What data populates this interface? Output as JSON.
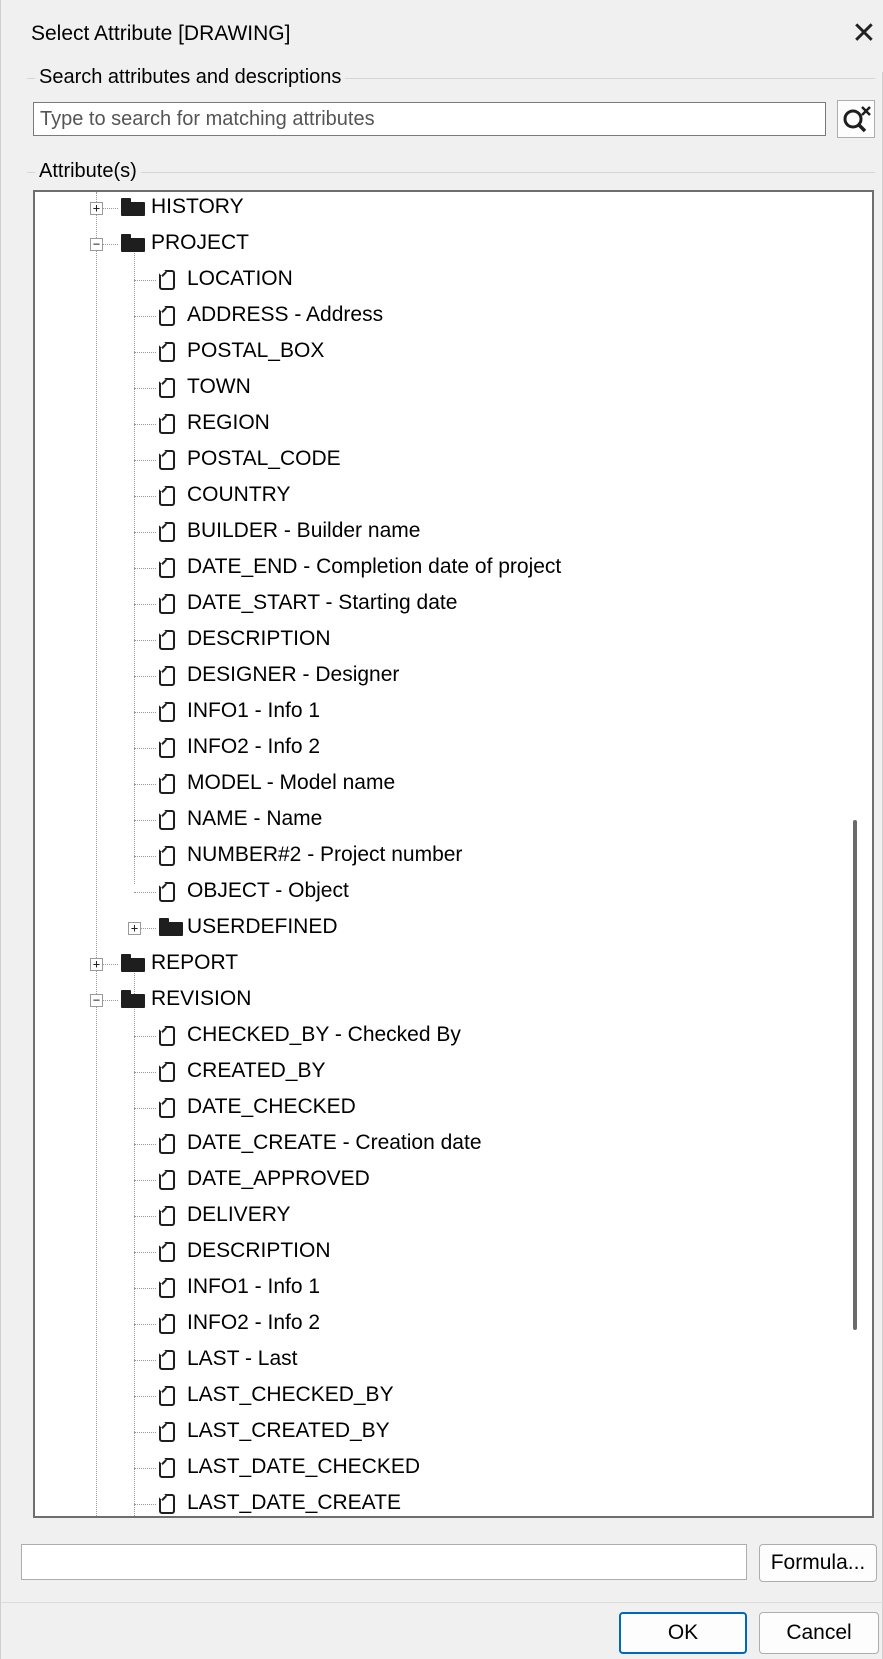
{
  "window": {
    "title": "Select Attribute [DRAWING]",
    "close_glyph": "✕"
  },
  "search": {
    "group_label": "Search attributes and descriptions",
    "placeholder": "Type to search for matching attributes",
    "clear_icon": "search-clear-icon"
  },
  "attributes": {
    "group_label": "Attribute(s)",
    "tree": [
      {
        "type": "folder",
        "level": 1,
        "label": "HISTORY",
        "expander": "+"
      },
      {
        "type": "folder",
        "level": 1,
        "label": "PROJECT",
        "expander": "−"
      },
      {
        "type": "leaf",
        "level": 2,
        "label": "LOCATION"
      },
      {
        "type": "leaf",
        "level": 2,
        "label": "ADDRESS  -  Address"
      },
      {
        "type": "leaf",
        "level": 2,
        "label": "POSTAL_BOX"
      },
      {
        "type": "leaf",
        "level": 2,
        "label": "TOWN"
      },
      {
        "type": "leaf",
        "level": 2,
        "label": "REGION"
      },
      {
        "type": "leaf",
        "level": 2,
        "label": "POSTAL_CODE"
      },
      {
        "type": "leaf",
        "level": 2,
        "label": "COUNTRY"
      },
      {
        "type": "leaf",
        "level": 2,
        "label": "BUILDER  -  Builder name"
      },
      {
        "type": "leaf",
        "level": 2,
        "label": "DATE_END  -  Completion date of project"
      },
      {
        "type": "leaf",
        "level": 2,
        "label": "DATE_START  -  Starting date"
      },
      {
        "type": "leaf",
        "level": 2,
        "label": "DESCRIPTION"
      },
      {
        "type": "leaf",
        "level": 2,
        "label": "DESIGNER  -  Designer"
      },
      {
        "type": "leaf",
        "level": 2,
        "label": "INFO1  -  Info 1"
      },
      {
        "type": "leaf",
        "level": 2,
        "label": "INFO2  -  Info 2"
      },
      {
        "type": "leaf",
        "level": 2,
        "label": "MODEL  -  Model name"
      },
      {
        "type": "leaf",
        "level": 2,
        "label": "NAME  -  Name"
      },
      {
        "type": "leaf",
        "level": 2,
        "label": "NUMBER#2  -  Project number"
      },
      {
        "type": "leaf",
        "level": 2,
        "label": "OBJECT  -  Object"
      },
      {
        "type": "folder",
        "level": 2,
        "label": "USERDEFINED",
        "expander": "+"
      },
      {
        "type": "folder",
        "level": 1,
        "label": "REPORT",
        "expander": "+"
      },
      {
        "type": "folder",
        "level": 1,
        "label": "REVISION",
        "expander": "−"
      },
      {
        "type": "leaf",
        "level": 2,
        "label": "CHECKED_BY  -  Checked By"
      },
      {
        "type": "leaf",
        "level": 2,
        "label": "CREATED_BY"
      },
      {
        "type": "leaf",
        "level": 2,
        "label": "DATE_CHECKED"
      },
      {
        "type": "leaf",
        "level": 2,
        "label": "DATE_CREATE  -  Creation date"
      },
      {
        "type": "leaf",
        "level": 2,
        "label": "DATE_APPROVED"
      },
      {
        "type": "leaf",
        "level": 2,
        "label": "DELIVERY"
      },
      {
        "type": "leaf",
        "level": 2,
        "label": "DESCRIPTION"
      },
      {
        "type": "leaf",
        "level": 2,
        "label": "INFO1  -  Info 1"
      },
      {
        "type": "leaf",
        "level": 2,
        "label": "INFO2  -  Info 2"
      },
      {
        "type": "leaf",
        "level": 2,
        "label": "LAST  -  Last"
      },
      {
        "type": "leaf",
        "level": 2,
        "label": "LAST_CHECKED_BY"
      },
      {
        "type": "leaf",
        "level": 2,
        "label": "LAST_CREATED_BY"
      },
      {
        "type": "leaf",
        "level": 2,
        "label": "LAST_DATE_CHECKED"
      },
      {
        "type": "leaf",
        "level": 2,
        "label": "LAST_DATE_CREATE"
      }
    ]
  },
  "footer": {
    "formula_value": "",
    "formula_button": "Formula...",
    "ok_button": "OK",
    "cancel_button": "Cancel"
  },
  "colors": {
    "dialog_bg": "#f0f0f0",
    "ok_border": "#0067c0"
  }
}
